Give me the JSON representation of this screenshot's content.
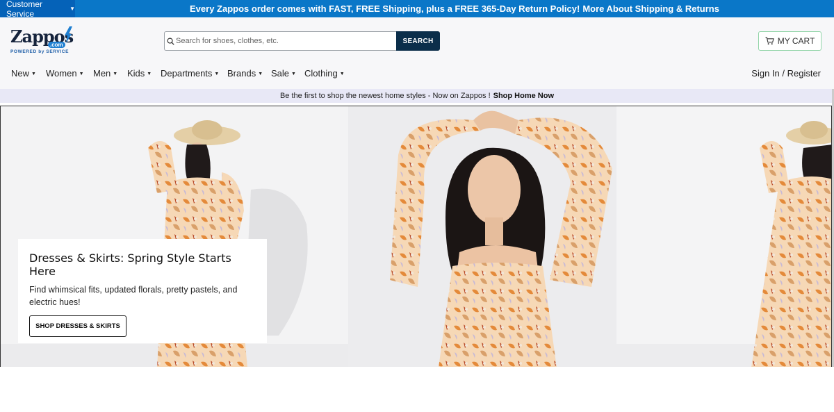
{
  "topbar": {
    "customer_service": "Customer Service",
    "promo_text": "Every Zappos order comes with FAST, FREE Shipping, plus a FREE 365-Day Return Policy!",
    "promo_link": "More About Shipping & Returns"
  },
  "header": {
    "logo_word": "Zappos",
    "logo_dotcom": ".com",
    "logo_tagline": "POWERED by SERVICE",
    "search_placeholder": "Search for shoes, clothes, etc.",
    "search_button": "SEARCH",
    "cart_label": "MY CART"
  },
  "nav": {
    "items": [
      {
        "label": "New"
      },
      {
        "label": "Women"
      },
      {
        "label": "Men"
      },
      {
        "label": "Kids"
      },
      {
        "label": "Departments"
      },
      {
        "label": "Brands"
      },
      {
        "label": "Sale"
      },
      {
        "label": "Clothing"
      }
    ],
    "signin": "Sign In / Register"
  },
  "subpromo": {
    "text": "Be the first to shop the newest home styles - Now on Zappos !",
    "link": "Shop Home Now"
  },
  "hero": {
    "title": "Dresses & Skirts: Spring Style Starts Here",
    "description": "Find whimsical fits, updated florals, pretty pastels, and electric hues!",
    "cta": "SHOP DRESSES & SKIRTS"
  },
  "colors": {
    "topbar_bg": "#0a77c8",
    "search_button_bg": "#0b2e4a",
    "cart_border": "#8fd3a6",
    "subpromo_bg": "#e8e8f6"
  }
}
